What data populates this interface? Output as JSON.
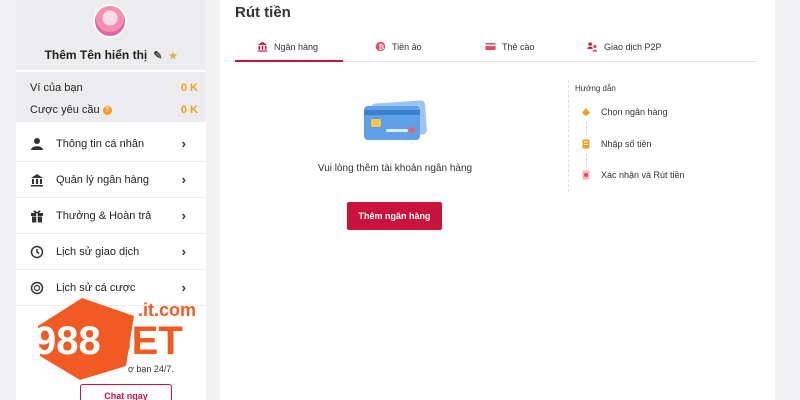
{
  "profile": {
    "display_name": "Thêm Tên hiển thị"
  },
  "wallet": {
    "wallet_label": "Ví của bạn",
    "wallet_value": "0 K",
    "bet_req_label": "Cược yêu cầu",
    "bet_req_value": "0 K"
  },
  "menu": {
    "items": [
      {
        "label": "Thông tin cá nhân",
        "icon": "user-icon"
      },
      {
        "label": "Quản lý ngân hàng",
        "icon": "bank-icon"
      },
      {
        "label": "Thưởng & Hoàn trả",
        "icon": "gift-icon"
      },
      {
        "label": "Lịch sử giao dịch",
        "icon": "history-icon"
      },
      {
        "label": "Lịch sử cá cược",
        "icon": "chip-icon"
      }
    ]
  },
  "support": {
    "text": "ợ bạn 24/7.",
    "chat_label": "Chat ngay"
  },
  "logo": {
    "text_main": "988BET",
    "text_domain": ".it.com"
  },
  "main": {
    "title": "Rút tiền",
    "tabs": [
      {
        "label": "Ngân hàng",
        "active": true
      },
      {
        "label": "Tiền ảo"
      },
      {
        "label": "Thẻ cào"
      },
      {
        "label": "Giao dịch P2P"
      }
    ],
    "empty_message": "Vui lòng thêm tài khoản ngân hàng",
    "add_bank_label": "Thêm ngân hàng"
  },
  "guide": {
    "title": "Hướng dẫn",
    "steps": [
      {
        "label": "Chọn ngân hàng"
      },
      {
        "label": "Nhập số tiền"
      },
      {
        "label": "Xác nhận và Rút tiền"
      }
    ]
  },
  "colors": {
    "accent": "#c8143c",
    "wallet_value": "#f0a020",
    "logo_orange": "#f15a22"
  }
}
